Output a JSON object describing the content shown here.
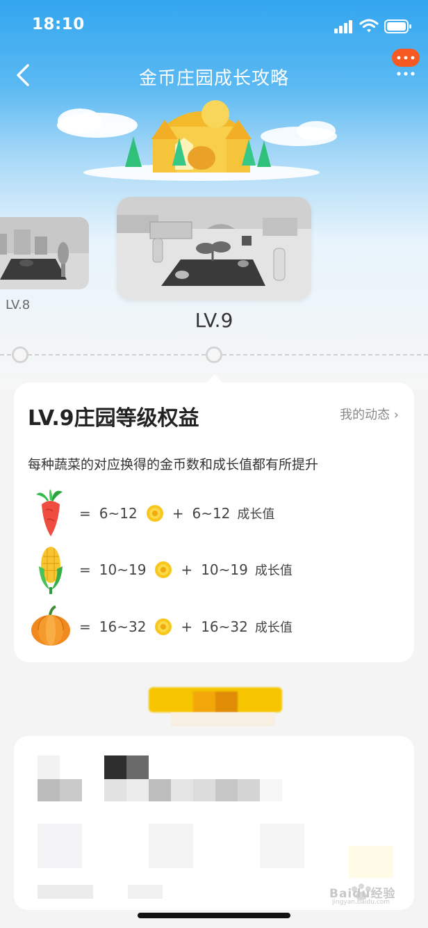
{
  "status_bar": {
    "time": "18:10"
  },
  "nav": {
    "title": "金币庄园成长攻略"
  },
  "levels": {
    "previous": {
      "label": "LV.8"
    },
    "current": {
      "label": "LV.9"
    }
  },
  "benefits": {
    "title": "LV.9庄园等级权益",
    "my_activity": "我的动态 ›",
    "description": "每种蔬菜的对应换得的金币数和成长值都有所提升",
    "rows": [
      {
        "vegetable": "carrot-icon",
        "coins": "6~12",
        "growth": "6~12",
        "growth_label": "成长值"
      },
      {
        "vegetable": "corn-icon",
        "coins": "10~19",
        "growth": "10~19",
        "growth_label": "成长值"
      },
      {
        "vegetable": "pumpkin-icon",
        "coins": "16~32",
        "growth": "16~32",
        "growth_label": "成长值"
      }
    ],
    "equals": "=",
    "plus": "+"
  },
  "watermark": {
    "text": "Baidu经验",
    "sub": "jingyan.baidu.com"
  },
  "colors": {
    "header_blue": "#33a6ef",
    "accent_orange": "#f65a22",
    "coin_yellow": "#f6c500"
  }
}
